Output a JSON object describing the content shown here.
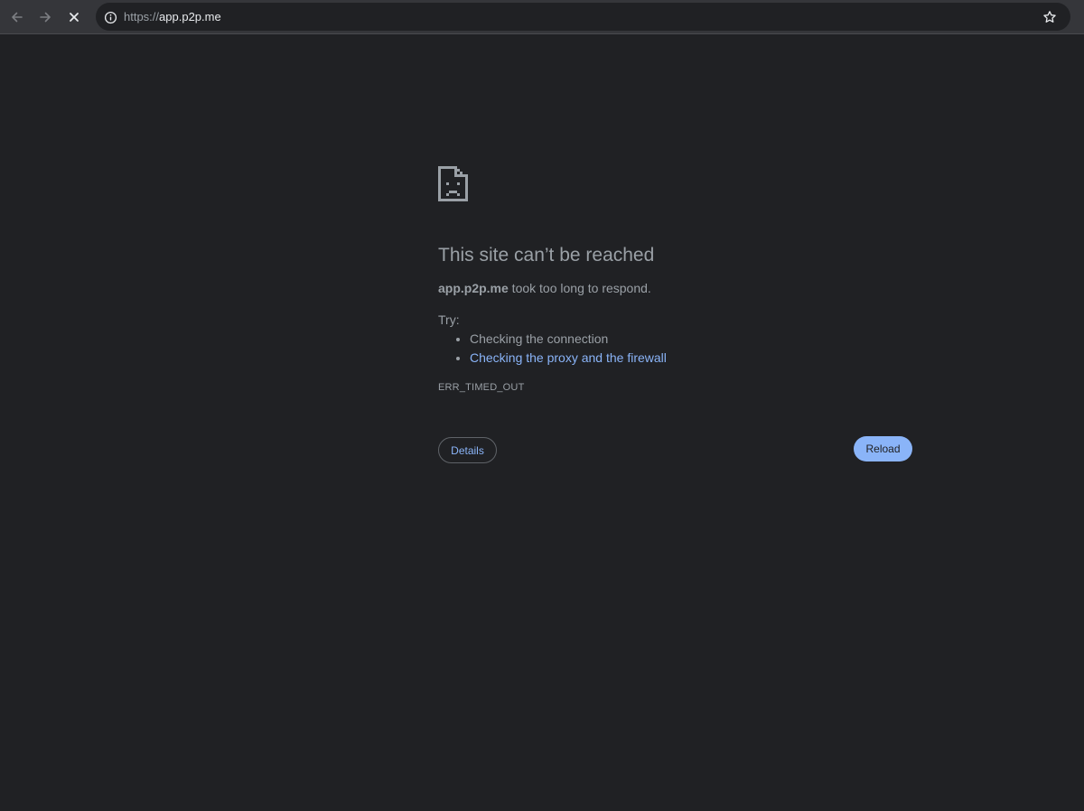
{
  "browser": {
    "url_scheme": "https://",
    "url_host": "app.p2p.me",
    "icons": {
      "back": "arrow-left-icon",
      "forward": "arrow-right-icon",
      "stop": "close-icon",
      "site_info": "info-icon",
      "bookmark": "star-icon"
    }
  },
  "error": {
    "icon": "sad-document-icon",
    "title": "This site can’t be reached",
    "host": "app.p2p.me",
    "description_suffix": " took too long to respond.",
    "try_label": "Try:",
    "suggestions": [
      "Checking the connection",
      "Checking the proxy and the firewall"
    ],
    "code": "ERR_TIMED_OUT",
    "details_label": "Details",
    "reload_label": "Reload"
  },
  "colors": {
    "background": "#202124",
    "toolbar": "#35363a",
    "text_secondary": "#9aa0a6",
    "link": "#8ab4f8",
    "primary_button": "#8ab4f8"
  }
}
